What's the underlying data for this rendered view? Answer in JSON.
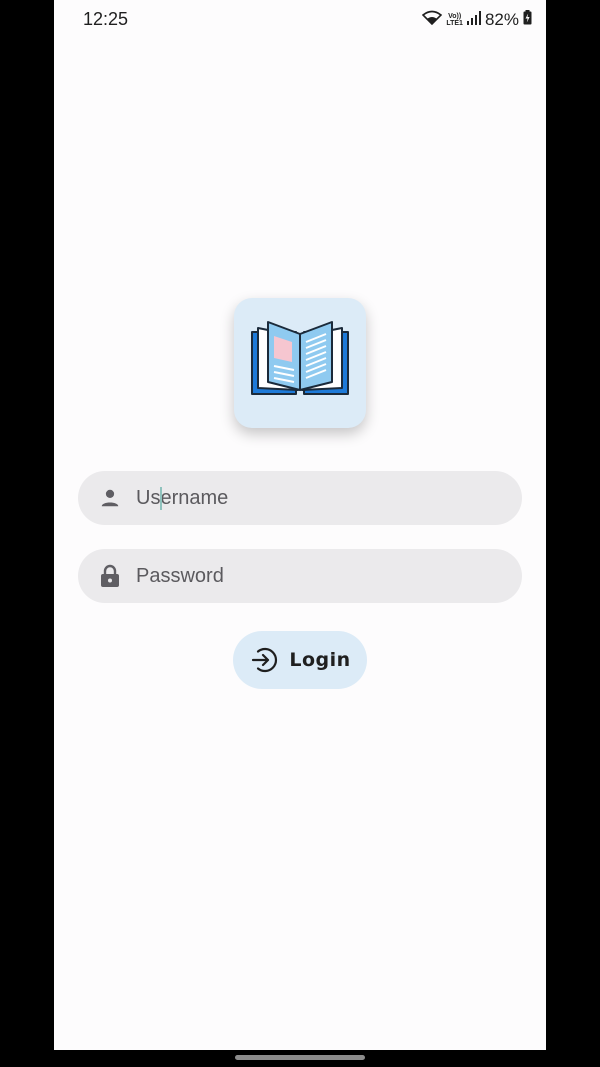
{
  "status_bar": {
    "time": "12:25",
    "network_label_top": "Vo))",
    "network_label_bottom": "LTE1",
    "battery_percent": "82%"
  },
  "login_form": {
    "username_placeholder": "Username",
    "password_placeholder": "Password",
    "login_label": "Login"
  },
  "icons": {
    "logo": "open-book-icon",
    "username": "person-icon",
    "password": "lock-icon",
    "login": "login-arrow-icon"
  },
  "colors": {
    "screen_background": "#fdfcfd",
    "field_background": "#ebeaec",
    "accent_background": "#dcebf7",
    "book_blue": "#1e7ad8",
    "book_light_blue": "#8fcaf0",
    "book_page_pink": "#f6c6d0"
  }
}
